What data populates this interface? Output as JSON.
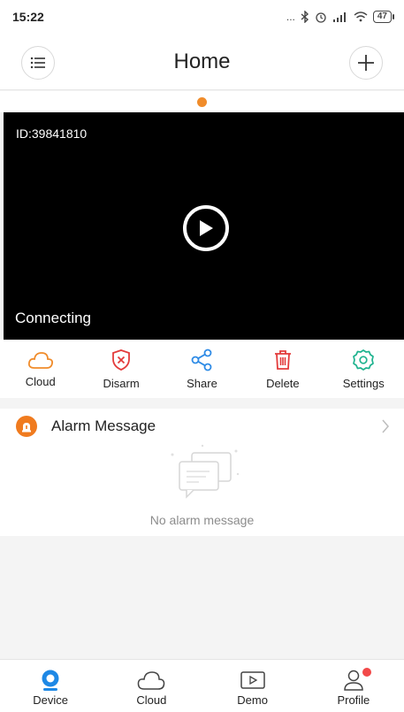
{
  "status_bar": {
    "time": "15:22",
    "signal": "...",
    "battery": "47"
  },
  "header": {
    "title": "Home"
  },
  "video": {
    "device_id": "ID:39841810",
    "status": "Connecting"
  },
  "actions": [
    {
      "label": "Cloud",
      "icon": "cloud-icon",
      "color": "#f08c2b"
    },
    {
      "label": "Disarm",
      "icon": "shield-x-icon",
      "color": "#e33b3b"
    },
    {
      "label": "Share",
      "icon": "share-icon",
      "color": "#2e8be6"
    },
    {
      "label": "Delete",
      "icon": "trash-icon",
      "color": "#e33b3b"
    },
    {
      "label": "Settings",
      "icon": "gear-icon",
      "color": "#1fb38f"
    }
  ],
  "alarm": {
    "title": "Alarm Message",
    "empty_text": "No alarm message"
  },
  "bottom_nav": [
    {
      "label": "Device",
      "icon": "device-icon"
    },
    {
      "label": "Cloud",
      "icon": "cloud-icon"
    },
    {
      "label": "Demo",
      "icon": "demo-play-icon"
    },
    {
      "label": "Profile",
      "icon": "profile-icon"
    }
  ],
  "colors": {
    "accent": "#f08c2b",
    "primary_blue": "#2e8be6",
    "notify": "#f24949"
  }
}
